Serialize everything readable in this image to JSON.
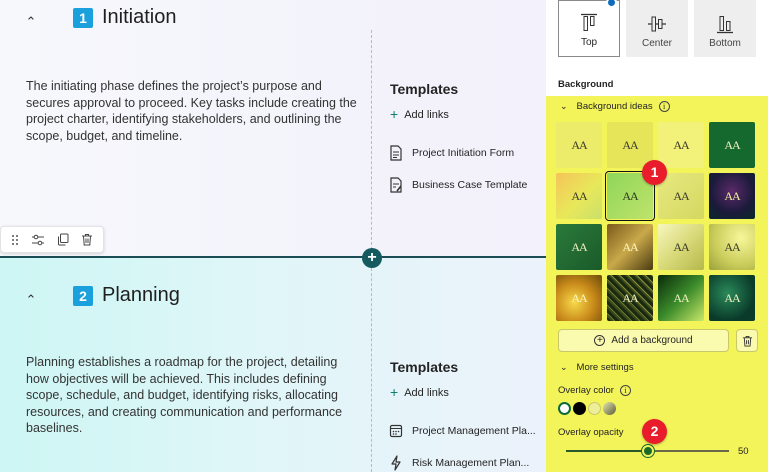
{
  "sections": [
    {
      "number": "1",
      "title": "Initiation",
      "description": "The initiating phase defines the project’s purpose and secures approval to proceed. Key tasks include creating the project charter, identifying stakeholders, and outlining the scope, budget, and timeline.",
      "templates_heading": "Templates",
      "add_links": "Add links",
      "templates": [
        "Project Initiation Form",
        "Business Case Template"
      ]
    },
    {
      "number": "2",
      "title": "Planning",
      "description": "Planning establishes a roadmap for the project, detailing how objectives will be achieved. This includes defining scope, schedule, and budget, identifying risks, allocating resources, and creating communication and performance baselines.",
      "templates_heading": "Templates",
      "add_links": "Add links",
      "templates": [
        "Project Management Pla...",
        "Risk Management Plan..."
      ]
    }
  ],
  "panel": {
    "alignment": {
      "options": [
        "Top",
        "Center",
        "Bottom"
      ],
      "selected": "Top"
    },
    "background_label": "Background",
    "background_ideas_label": "Background ideas",
    "tile_text": "AA",
    "selected_tile_index": 5,
    "add_background_label": "Add a background",
    "more_settings_label": "More settings",
    "overlay_color_label": "Overlay color",
    "overlay_colors": [
      "#ffffff",
      "#000000",
      "#eded9a",
      "#7a7a5a"
    ],
    "overlay_opacity_label": "Overlay opacity",
    "overlay_opacity_value": "50"
  },
  "callouts": [
    "1",
    "2"
  ],
  "colors": {
    "accent_yellow": "#f3f35a",
    "badge_blue": "#1aa0dc",
    "callout_red": "#e81c2a",
    "divider_teal": "#145a5f"
  }
}
